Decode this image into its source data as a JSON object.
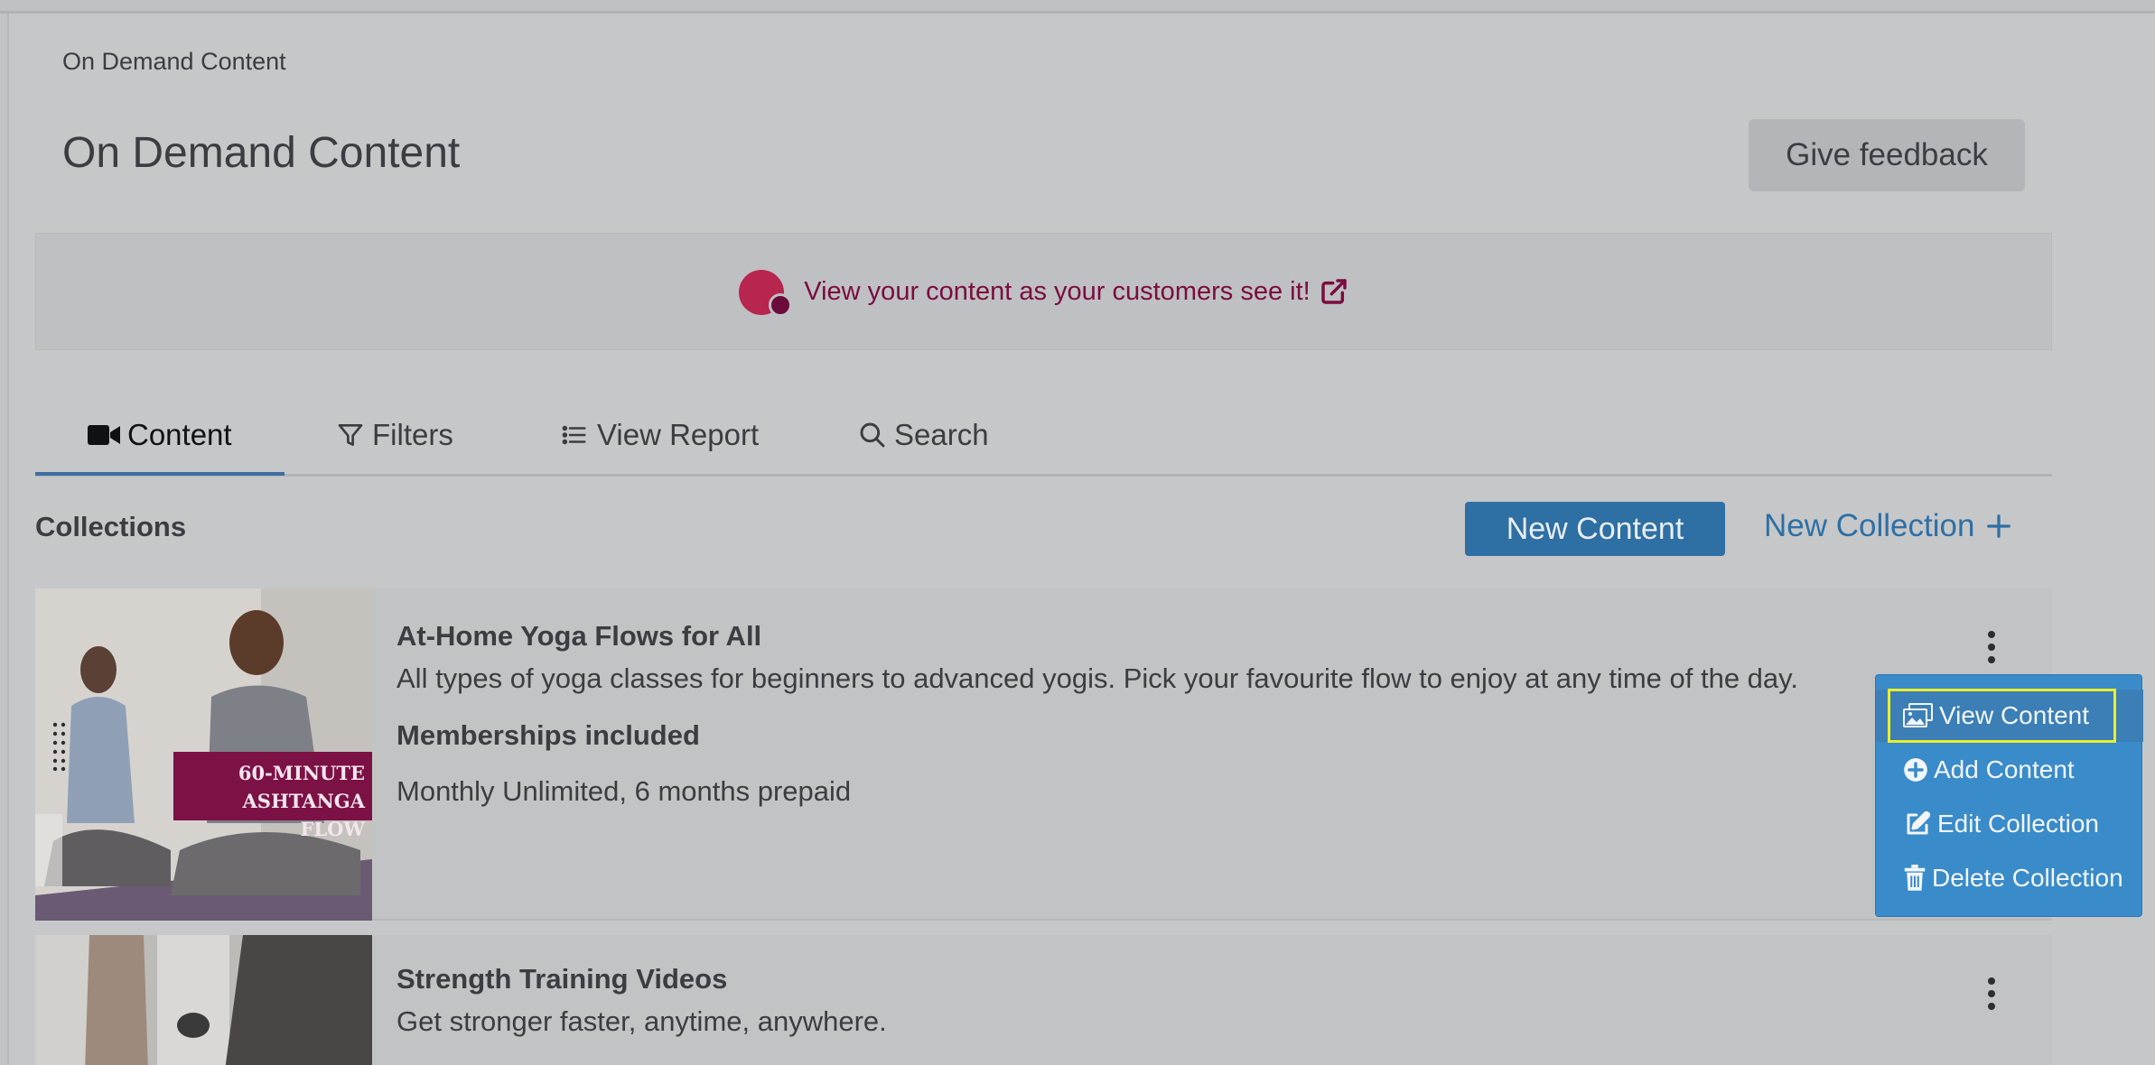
{
  "breadcrumb": "On Demand Content",
  "page_title": "On Demand Content",
  "feedback_button": "Give feedback",
  "banner": {
    "link_text": "View your content as your customers see it!"
  },
  "tabs": [
    {
      "label": "Content",
      "icon": "video-camera-icon",
      "active": true
    },
    {
      "label": "Filters",
      "icon": "filter-icon",
      "active": false
    },
    {
      "label": "View Report",
      "icon": "list-icon",
      "active": false
    },
    {
      "label": "Search",
      "icon": "search-icon",
      "active": false
    }
  ],
  "collections": {
    "heading": "Collections",
    "new_content_button": "New Content",
    "new_collection_link": "New Collection",
    "items": [
      {
        "title": "At-Home Yoga Flows for All",
        "description": "All types of yoga classes for beginners to advanced yogis. Pick your favourite flow to enjoy at any time of the day.",
        "memberships_heading": "Memberships included",
        "memberships": "Monthly Unlimited, 6 months prepaid",
        "thumbnail_caption_line1": "60-MINUTE",
        "thumbnail_caption_line2": "ASHTANGA FLOW"
      },
      {
        "title": "Strength Training Videos",
        "description": "Get stronger faster, anytime, anywhere."
      }
    ]
  },
  "menu": {
    "items": [
      {
        "label": "View Content",
        "icon": "images-icon"
      },
      {
        "label": "Add Content",
        "icon": "plus-circle-icon"
      },
      {
        "label": "Edit Collection",
        "icon": "edit-icon"
      },
      {
        "label": "Delete Collection",
        "icon": "trash-icon"
      }
    ]
  },
  "colors": {
    "primary": "#2e6fa4",
    "brand": "#7a0c3f",
    "menu_bg": "#3a8bc9",
    "highlight": "#e9ee2a"
  }
}
